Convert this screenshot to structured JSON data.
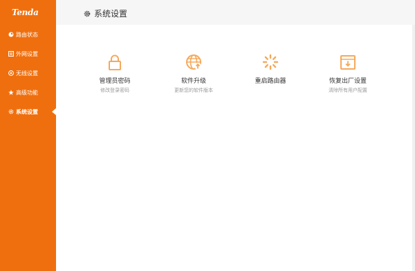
{
  "brand": {
    "logo": "Tenda",
    "accent": "#ef6f0e"
  },
  "sidebar": {
    "items": [
      {
        "label": "路由状态",
        "icon": "status-circle-icon",
        "active": false
      },
      {
        "label": "外网设置",
        "icon": "wan-box-icon",
        "active": false
      },
      {
        "label": "无线设置",
        "icon": "wireless-icon",
        "active": false
      },
      {
        "label": "高级功能",
        "icon": "star-icon",
        "active": false
      },
      {
        "label": "系统设置",
        "icon": "gear-icon",
        "active": true
      }
    ]
  },
  "header": {
    "title": "系统设置",
    "icon": "gear-icon"
  },
  "tiles": [
    {
      "title": "管理员密码",
      "desc": "修改登录密码",
      "icon": "lock-icon"
    },
    {
      "title": "软件升级",
      "desc": "更新您的软件版本",
      "icon": "globe-upgrade-icon"
    },
    {
      "title": "重启路由器",
      "desc": "",
      "icon": "reboot-spinner-icon"
    },
    {
      "title": "恢复出厂设置",
      "desc": "清除所有用户配置",
      "icon": "factory-reset-icon"
    }
  ]
}
